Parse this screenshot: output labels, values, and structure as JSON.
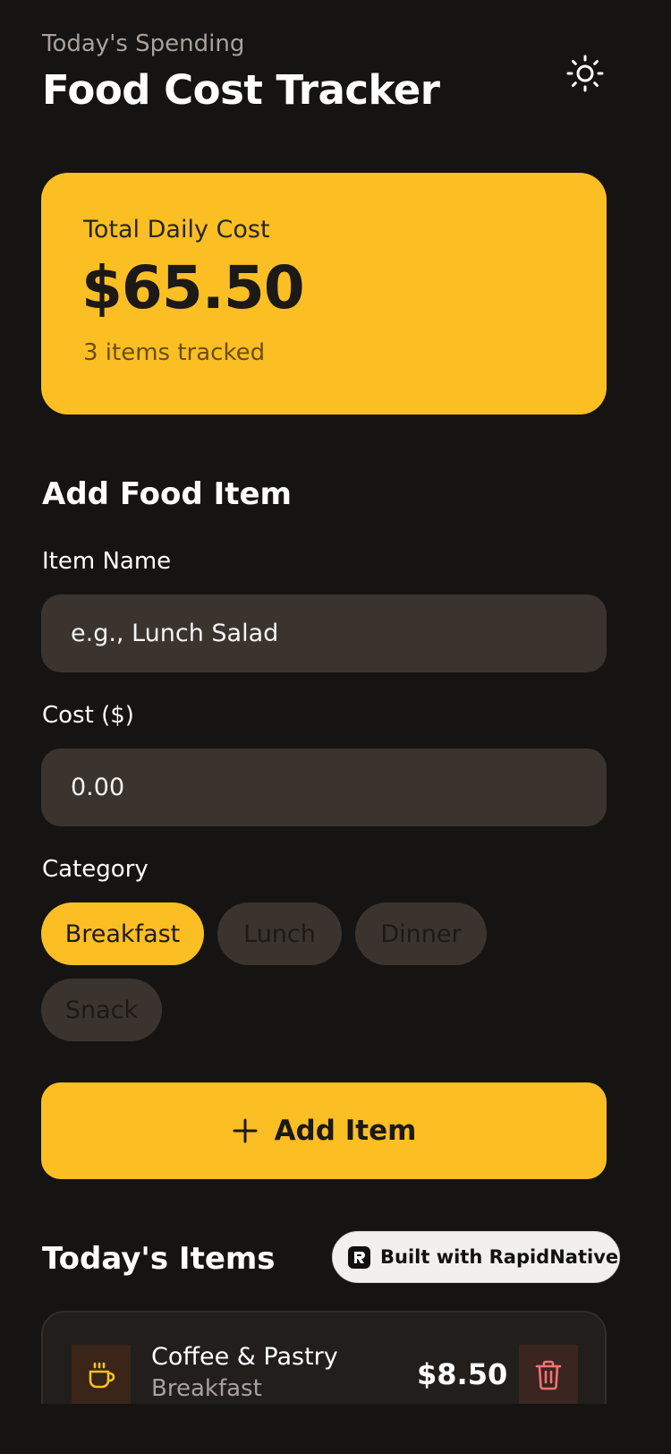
{
  "header": {
    "subtitle": "Today's Spending",
    "title": "Food Cost Tracker",
    "theme_toggle_icon": "sun-icon"
  },
  "summary": {
    "label": "Total Daily Cost",
    "total": "$65.50",
    "count_text": "3 items tracked"
  },
  "form": {
    "section_title": "Add Food Item",
    "name_label": "Item Name",
    "name_placeholder": "e.g., Lunch Salad",
    "name_value": "",
    "cost_label": "Cost ($)",
    "cost_placeholder": "0.00",
    "cost_value": "",
    "category_label": "Category",
    "categories": [
      "Breakfast",
      "Lunch",
      "Dinner",
      "Snack"
    ],
    "selected_category": "Breakfast",
    "add_button_label": "Add Item",
    "add_button_icon": "plus-icon"
  },
  "items_section": {
    "title": "Today's Items",
    "items": [
      {
        "name": "Coffee & Pastry",
        "category": "Breakfast",
        "price": "$8.50",
        "icon": "coffee-cup-icon",
        "delete_icon": "trash-icon"
      }
    ]
  },
  "badge": {
    "label": "Built with RapidNative",
    "icon": "rapidnative-logo-icon"
  },
  "colors": {
    "background": "#161412",
    "accent": "#fbbf24",
    "input_background": "#3b342e",
    "card_background": "#211e1b",
    "danger": "#f87171"
  }
}
